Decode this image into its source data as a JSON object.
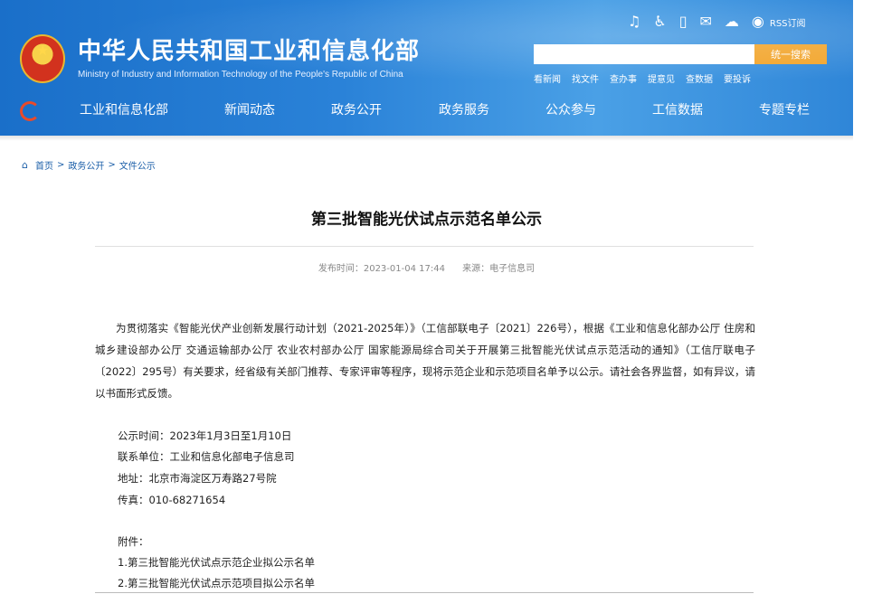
{
  "header": {
    "title": "中华人民共和国工业和信息化部",
    "subtitle": "Ministry of Industry and Information Technology of the People's Republic of China",
    "rss_label": "RSS订阅",
    "search_button": "统一搜索",
    "quick_links": [
      "看新闻",
      "找文件",
      "查办事",
      "提意见",
      "查数据",
      "要投诉"
    ]
  },
  "nav": {
    "items": [
      "工业和信息化部",
      "新闻动态",
      "政务公开",
      "政务服务",
      "公众参与",
      "工信数据",
      "专题专栏"
    ]
  },
  "breadcrumb": {
    "items": [
      "首页",
      "政务公开",
      "文件公示"
    ],
    "separator": ">"
  },
  "article": {
    "title": "第三批智能光伏试点示范名单公示",
    "published_label": "发布时间：2023-01-04 17:44",
    "source_label": "来源：电子信息司",
    "body": "为贯彻落实《智能光伏产业创新发展行动计划（2021-2025年）》（工信部联电子〔2021〕226号），根据《工业和信息化部办公厅 住房和城乡建设部办公厅 交通运输部办公厅 农业农村部办公厅 国家能源局综合司关于开展第三批智能光伏试点示范活动的通知》（工信厅联电子〔2022〕295号）有关要求，经省级有关部门推荐、专家评审等程序，现将示范企业和示范项目名单予以公示。请社会各界监督，如有异议，请以书面形式反馈。",
    "info": [
      "公示时间：2023年1月3日至1月10日",
      "联系单位：工业和信息化部电子信息司",
      "地址：北京市海淀区万寿路27号院",
      "传真：010-68271654"
    ],
    "attachments_label": "附件：",
    "attachments": [
      "1.第三批智能光伏试点示范企业拟公示名单",
      "2.第三批智能光伏试点示范项目拟公示名单"
    ]
  }
}
